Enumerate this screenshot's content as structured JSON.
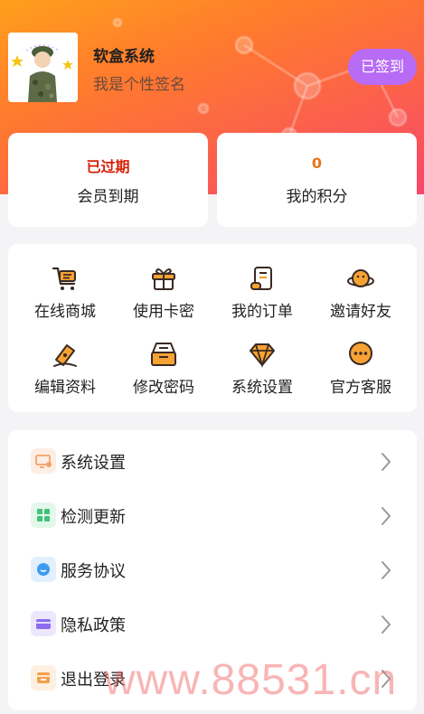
{
  "profile": {
    "username": "软盒系统",
    "signature": "我是个性签名",
    "signin_label": "已签到"
  },
  "stats": {
    "membership": {
      "value": "已过期",
      "label": "会员到期",
      "color": "#d81e06"
    },
    "points": {
      "value": "0",
      "label": "我的积分",
      "color": "#e8731c"
    }
  },
  "grid": [
    {
      "label": "在线商城",
      "icon": "cart-icon"
    },
    {
      "label": "使用卡密",
      "icon": "gift-icon"
    },
    {
      "label": "我的订单",
      "icon": "order-scroll-icon"
    },
    {
      "label": "邀请好友",
      "icon": "invite-planet-icon"
    },
    {
      "label": "编辑资料",
      "icon": "edit-pen-icon"
    },
    {
      "label": "修改密码",
      "icon": "password-box-icon"
    },
    {
      "label": "系统设置",
      "icon": "diamond-settings-icon"
    },
    {
      "label": "官方客服",
      "icon": "chat-bubble-icon"
    }
  ],
  "menu": [
    {
      "label": "系统设置",
      "icon": "monitor-settings-icon",
      "color": "#f2a067"
    },
    {
      "label": "检测更新",
      "icon": "grid-update-icon",
      "color": "#3fc47a"
    },
    {
      "label": "服务协议",
      "icon": "chat-dot-icon",
      "color": "#3d9cf0"
    },
    {
      "label": "隐私政策",
      "icon": "card-icon",
      "color": "#8b6cf0"
    },
    {
      "label": "退出登录",
      "icon": "logout-box-icon",
      "color": "#f5a04a"
    }
  ],
  "watermark": "www.88531.cn",
  "colors": {
    "accent_orange": "#ff7a2e",
    "accent_pink": "#f8476a",
    "signin_purple": "#b86bf5",
    "icon_stroke": "#3a2a22",
    "icon_fill": "#f7a234"
  }
}
